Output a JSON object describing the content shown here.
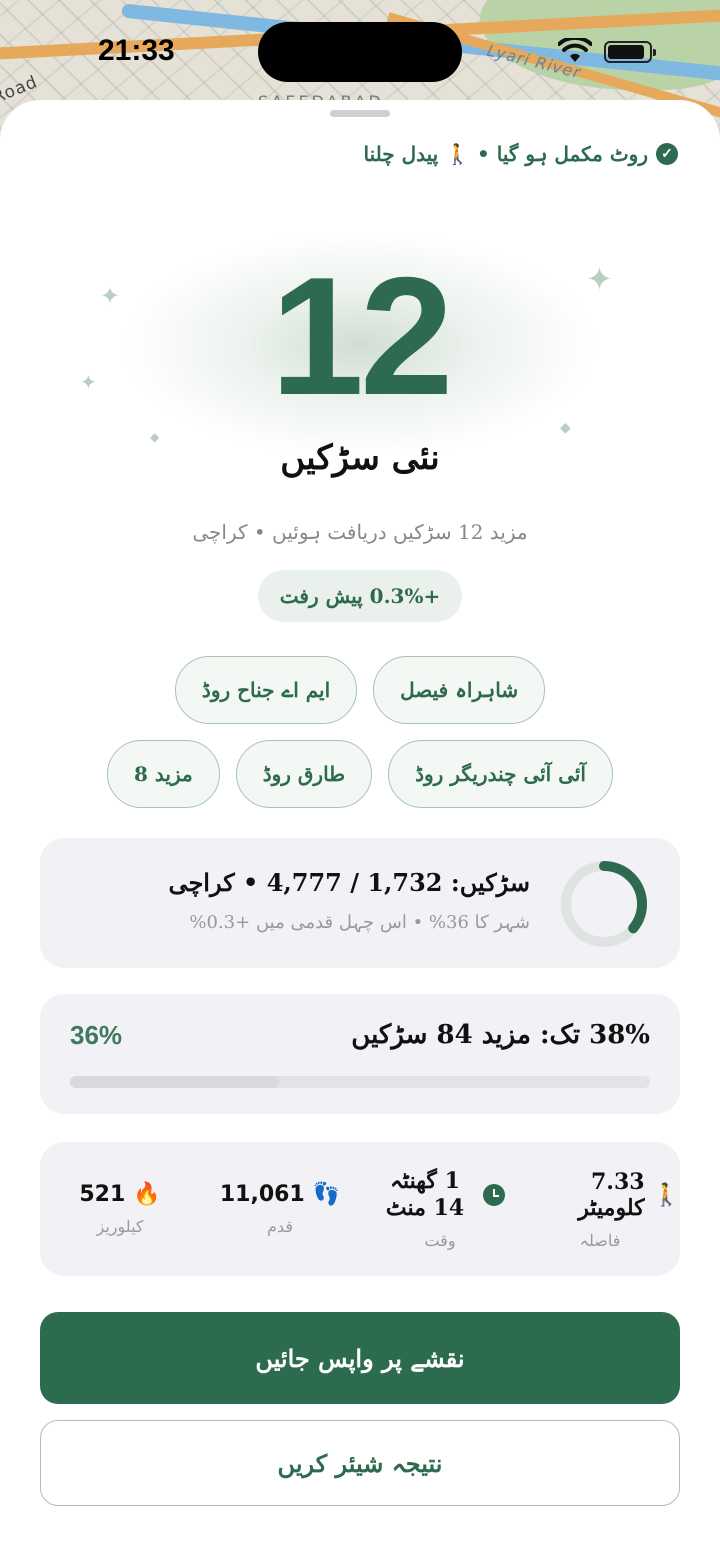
{
  "status_bar": {
    "time": "21:33"
  },
  "map": {
    "labels": {
      "river": "Lyari River",
      "road": "Road",
      "area": "SAEEDABAD"
    }
  },
  "sheet": {
    "route_status": "روٹ مکمل ہو گیا • 🚶 پیدل چلنا",
    "new_roads_count": "12",
    "new_roads_label": "نئی سڑکیں",
    "subline": "مزید 12 سڑکیں دریافت ہوئیں • کراچی",
    "progress_pill": "+0.3% پیش رفت",
    "chips": [
      "شاہراہ فیصل",
      "ایم اے جناح روڈ",
      "آئی آئی چندریگر روڈ",
      "طارق روڈ",
      "مزید 8"
    ],
    "city_card": {
      "line1": "سڑکیں: 1,732 / 4,777 • کراچی",
      "line2": "شہر کا 36% • اس چہل قدمی میں +0.3%",
      "progress": 0.36
    },
    "goal_card": {
      "title": "38% تک: مزید 84 سڑکیں",
      "percent": "36%"
    },
    "stats": [
      {
        "value": "7.33 کلومیٹر",
        "label": "فاصلہ",
        "icon": "walk-icon"
      },
      {
        "value": "1 گھنٹہ 14 منٹ",
        "label": "وقت",
        "icon": "clock-icon"
      },
      {
        "value": "11,061",
        "label": "قدم",
        "icon": "footsteps-icon"
      },
      {
        "value": "521",
        "label": "کیلوریز",
        "icon": "flame-icon"
      }
    ],
    "primary_button": "نقشے پر واپس جائیں",
    "secondary_button": "نتیجہ شیئر کریں"
  },
  "colors": {
    "accent": "#2e6a4f",
    "card_bg": "#f2f2f6",
    "muted_text": "#999999"
  }
}
